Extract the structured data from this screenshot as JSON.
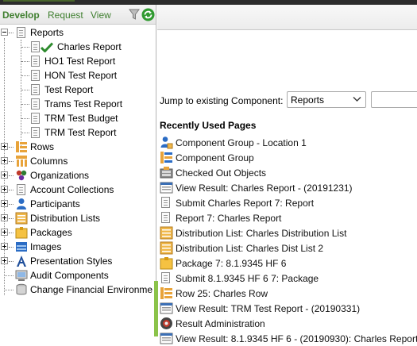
{
  "nav_tabs": [
    {
      "label": "Develop",
      "active": true
    },
    {
      "label": "Request",
      "active": false
    },
    {
      "label": "View",
      "active": false
    }
  ],
  "tree": {
    "reports": {
      "label": "Reports",
      "children": [
        {
          "label": "Charles Report",
          "checked": true
        },
        {
          "label": "HO1 Test Report"
        },
        {
          "label": "HON Test Report"
        },
        {
          "label": "Test Report"
        },
        {
          "label": "Trams Test Report"
        },
        {
          "label": "TRM Test Budget"
        },
        {
          "label": "TRM Test Report"
        }
      ]
    },
    "nodes": [
      {
        "label": "Rows",
        "icon": "rows-icon"
      },
      {
        "label": "Columns",
        "icon": "columns-icon"
      },
      {
        "label": "Organizations",
        "icon": "organizations-icon"
      },
      {
        "label": "Account Collections",
        "icon": "account-collections-icon"
      },
      {
        "label": "Participants",
        "icon": "participants-icon"
      },
      {
        "label": "Distribution Lists",
        "icon": "distribution-lists-icon"
      },
      {
        "label": "Packages",
        "icon": "packages-icon"
      },
      {
        "label": "Images",
        "icon": "images-icon"
      },
      {
        "label": "Presentation Styles",
        "icon": "presentation-styles-icon"
      },
      {
        "label": "Audit Components",
        "icon": "audit-components-icon"
      },
      {
        "label": "Change Financial Environme",
        "icon": "database-icon"
      }
    ]
  },
  "jump": {
    "label": "Jump to existing Component:",
    "selected": "Reports",
    "input_value": ""
  },
  "recent": {
    "title": "Recently Used Pages",
    "items": [
      {
        "text": "Component Group - Location 1",
        "icon": "component-group-icon"
      },
      {
        "text": "Component Group",
        "icon": "component-group-icon"
      },
      {
        "text": "Checked Out Objects",
        "icon": "checked-out-icon"
      },
      {
        "text": "View Result: Charles Report - (20191231)",
        "icon": "view-result-icon"
      },
      {
        "text": "Submit Charles Report 7: Report",
        "icon": "document-icon"
      },
      {
        "text": "Report 7: Charles Report",
        "icon": "document-icon"
      },
      {
        "text": "Distribution List: Charles Distribution List",
        "icon": "distribution-list-icon"
      },
      {
        "text": "Distribution List: Charles Dist List 2",
        "icon": "distribution-list-icon"
      },
      {
        "text": "Package 7: 8.1.9345 HF 6",
        "icon": "package-icon"
      },
      {
        "text": "Submit 8.1.9345 HF 6 7: Package",
        "icon": "document-icon"
      },
      {
        "text": "Row 25: Charles Row",
        "icon": "row-icon"
      },
      {
        "text": "View Result: TRM Test Report - (20190331)",
        "icon": "view-result-icon"
      },
      {
        "text": "Result Administration",
        "icon": "result-admin-icon"
      },
      {
        "text": "View Result: 8.1.9345 HF 6 - (20190930): Charles Report",
        "icon": "view-result-icon"
      }
    ]
  }
}
